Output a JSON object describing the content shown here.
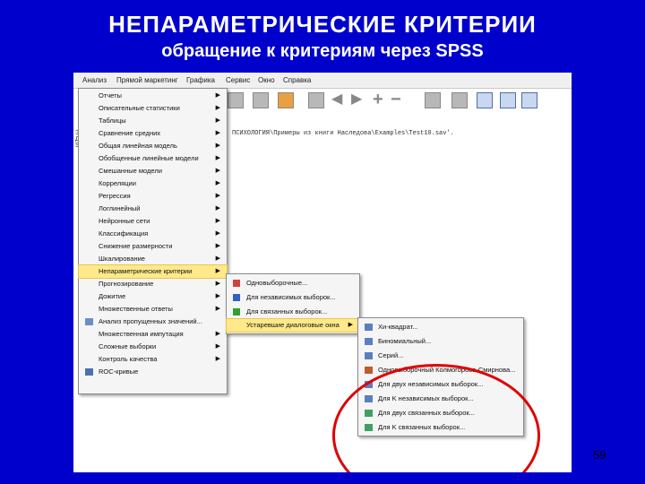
{
  "slide": {
    "title": "НЕПАРАМЕТРИЧЕСКИЕ  КРИТЕРИИ",
    "subtitle": "обращение к критериям через SPSS",
    "page_number": "59"
  },
  "menubar": [
    "Анализ",
    "Прямой маркетинг",
    "Графика",
    "Сервис",
    "Окно",
    "Справка"
  ],
  "syntax_line": "ПСИХОЛОГИЯ\\Примеры из книги Наследова\\Examples\\Test10.sav'.",
  "left_marks": [
    "Э",
    "Д",
    "S"
  ],
  "analyze_menu": [
    {
      "label": "Отчеты",
      "submenu": true
    },
    {
      "label": "Описательные статистики",
      "submenu": true
    },
    {
      "label": "Таблицы",
      "submenu": true
    },
    {
      "label": "Сравнение средних",
      "submenu": true
    },
    {
      "label": "Общая линейная модель",
      "submenu": true
    },
    {
      "label": "Обобщенные линейные модели",
      "submenu": true
    },
    {
      "label": "Смешанные модели",
      "submenu": true
    },
    {
      "label": "Корреляции",
      "submenu": true
    },
    {
      "label": "Регрессия",
      "submenu": true
    },
    {
      "label": "Логлинейный",
      "submenu": true
    },
    {
      "label": "Нейронные сети",
      "submenu": true
    },
    {
      "label": "Классификация",
      "submenu": true
    },
    {
      "label": "Снижение размерности",
      "submenu": true
    },
    {
      "label": "Шкалирование",
      "submenu": true
    },
    {
      "label": "Непараметрические критерии",
      "submenu": true,
      "highlighted": true
    },
    {
      "label": "Прогнозирование",
      "submenu": true
    },
    {
      "label": "Дожитие",
      "submenu": true
    },
    {
      "label": "Множественные ответы",
      "submenu": true
    },
    {
      "label": "Анализ пропущенных значений...",
      "submenu": false,
      "icon": true
    },
    {
      "label": "Множественная импутация",
      "submenu": true
    },
    {
      "label": "Сложные выборки",
      "submenu": true
    },
    {
      "label": "Контроль качества",
      "submenu": true
    },
    {
      "label": "ROC-кривые",
      "submenu": false,
      "icon": true
    }
  ],
  "nonparam_menu": [
    {
      "label": "Одновыборочные...",
      "icon_color": "#d04040"
    },
    {
      "label": "Для независимых выборок...",
      "icon_color": "#3060c0"
    },
    {
      "label": "Для связанных выборок...",
      "icon_color": "#30a030"
    },
    {
      "label": "Устаревшие диалоговые окна",
      "submenu": true,
      "highlighted": true
    }
  ],
  "legacy_menu": [
    {
      "label": "Хи-квадрат..."
    },
    {
      "label": "Биномиальный..."
    },
    {
      "label": "Серий..."
    },
    {
      "label": "Одновыборочный Колмогорова-Смирнова..."
    },
    {
      "label": "Для двух независимых выборок..."
    },
    {
      "label": "Для K независимых выборок..."
    },
    {
      "label": "Для двух связанных выборок..."
    },
    {
      "label": "Для K связанных выборок..."
    }
  ],
  "colors": {
    "slide_bg": "#0000cc",
    "highlight": "#ffe98a",
    "ellipse": "#e00000"
  }
}
